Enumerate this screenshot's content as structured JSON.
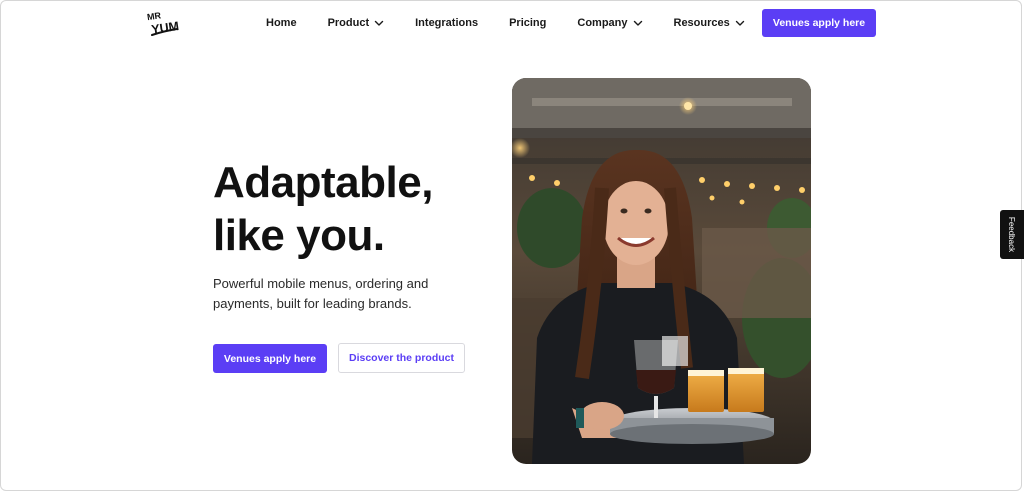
{
  "header": {
    "logo": {
      "line1": "MR",
      "line2": "YUM",
      "icon": "mr-yum-logo"
    },
    "nav": [
      {
        "label": "Home",
        "has_dropdown": false
      },
      {
        "label": "Product",
        "has_dropdown": true
      },
      {
        "label": "Integrations",
        "has_dropdown": false
      },
      {
        "label": "Pricing",
        "has_dropdown": false
      },
      {
        "label": "Company",
        "has_dropdown": true
      },
      {
        "label": "Resources",
        "has_dropdown": true
      }
    ],
    "cta_label": "Venues apply here"
  },
  "hero": {
    "title_line1": "Adaptable,",
    "title_line2": "like you.",
    "subtitle": "Powerful mobile menus, ordering and payments, built for leading brands.",
    "primary_button": "Venues apply here",
    "secondary_button": "Discover the product",
    "image_description_icon": "photo-server-with-drinks-tray"
  },
  "feedback": {
    "label": "Feedback"
  },
  "colors": {
    "brand": "#5b3ef5",
    "text": "#111111",
    "background": "#ffffff",
    "feedback_bg": "#111111"
  }
}
